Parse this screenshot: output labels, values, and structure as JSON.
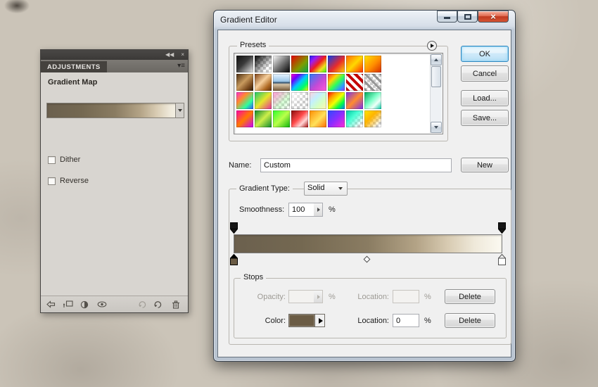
{
  "colors": {
    "stop_color": "#6b5c45",
    "gradient_bar": "linear-gradient(to right, #6b604e 0%, #746851 25%, #8a7c62 50%, #b3a386 68%, #d8cbb2 80%, #efe9da 90%, #fbf9f1 100%)"
  },
  "adjustments": {
    "collapse_icon": "◀◀",
    "close_icon": "×",
    "menu_icon": "▾≡",
    "tab": "ADJUSTMENTS",
    "title": "Gradient Map",
    "dither_label": "Dither",
    "reverse_label": "Reverse"
  },
  "dialog": {
    "title": "Gradient Editor",
    "buttons": {
      "ok": "OK",
      "cancel": "Cancel",
      "load": "Load...",
      "save": "Save...",
      "new": "New"
    },
    "name": {
      "label": "Name:",
      "value": "Custom"
    },
    "gradient_type": {
      "label": "Gradient Type:",
      "value": "Solid"
    },
    "smoothness": {
      "label": "Smoothness:",
      "value": "100"
    },
    "percent": "%",
    "presets": {
      "label": "Presets",
      "items": [
        "linear-gradient(135deg,#111 0%,#3a3a3a 45%,#e8e8e8 100%)",
        "linear-gradient(135deg,#000 0%,rgba(0,0,0,0) 75%), repeating-conic-gradient(#cbcbcb 0% 25%,#fff 0% 50%) 0 0/8px 8px",
        "linear-gradient(135deg,#fff 0%,#777 50%,#000 100%)",
        "linear-gradient(135deg,#e70000 0%,#7d9c00 60%,#00a651 100%)",
        "linear-gradient(135deg,#1524f5 0%,#9c1df0 25%,#f01d1d 50%,#f0e11d 75%,#2df01d 100%)",
        "linear-gradient(135deg,#0540f2 0%,#e82b2b 55%,#ffd400 100%)",
        "linear-gradient(135deg,#ff6a00 0%,#ffd800 50%,#ff2a00 100%)",
        "linear-gradient(135deg,#ffe600 0%,#ff8c00 55%,#d42b00 100%)",
        "linear-gradient(135deg,#4a2c10 0%,#c89a5e 45%,#7a4a1e 75%,#2f1c08 100%)",
        "linear-gradient(135deg,#7c3f12 0%,#f6cf9c 45%,#b06a24 75%,#5d2f0c 100%)",
        "linear-gradient(180deg,#e9f5ff 0%,#9cc6e8 44%,#30506e 52%,#d8c5a8 62%,#715636 100%)",
        "linear-gradient(135deg,#ff00cc 0%,#6a00ff 25%,#00c8ff 50%,#00ff66 75%,#ffee00 100%)",
        "linear-gradient(135deg,#2a7cf7 0%,#c44ad6 55%,#ff5ad5 100%)",
        "linear-gradient(135deg,#ff2d2d 0%,#ffd400 30%,#2dff5a 55%,#2d9bff 80%,#a02dff 100%)",
        "repeating-linear-gradient(45deg,#c40000 0 4px,#fff 4px 8px)",
        "repeating-linear-gradient(45deg,rgba(140,140,140,.9) 0 3px,rgba(255,255,255,0) 3px 8px), repeating-conic-gradient(#cbcbcb 0% 25%,#fff 0% 50%) 0 0/8px 8px",
        "linear-gradient(135deg,#ff2dce 0%,#ff8c2d 35%,#2dff9b 70%,#2d55ff 100%)",
        "linear-gradient(135deg,#19c86e 0%,#e6e62d 50%,#e62d9b 100%)",
        "linear-gradient(135deg,#ff9bd5 0%,rgba(155,255,155,.4) 60%,rgba(255,255,255,0) 100%), repeating-conic-gradient(#cbcbcb 0% 25%,#fff 0% 50%) 0 0/8px 8px",
        "linear-gradient(135deg,#fff 0%,rgba(255,255,255,0) 60%), repeating-conic-gradient(#cbcbcb 0% 25%,#fff 0% 50%) 0 0/8px 8px",
        "linear-gradient(135deg,#ffd1dc 0%,#c3f0ff 35%,#d5ffc3 65%,#fff3b0 100%)",
        "linear-gradient(135deg,#ff0000 0%,#ff9b00 25%,#f2ff00 50%,#00ff44 75%,#0077ff 100%)",
        "linear-gradient(135deg,#7a2df0 0%,#ff8c2d 50%,#7a2df0 100%)",
        "linear-gradient(135deg,#00a85a 0%,#7dffc8 45%,#f0fff8 70%,#00c8a0 100%)",
        "linear-gradient(135deg,#ff00a8 0%,#ff7a00 50%,#c800ff 100%)",
        "linear-gradient(135deg,#0b8a2d 0%,#cdee4a 50%,#0b8a2d 100%)",
        "linear-gradient(135deg,#2dff2d 0%,#baff4a 50%,#0bb40b 100%)",
        "linear-gradient(135deg,#8a0b0b 0%,#ff4a4a 45%,#ffd5d5 70%,#a80b0b 100%)",
        "linear-gradient(135deg,#ff8c00 0%,#ffe15a 55%,#ff6a00 100%)",
        "linear-gradient(135deg,#2d4aff 0%,#8c2dff 50%,#ff2dd5 100%)",
        "linear-gradient(135deg,#00c8a0 0%,#4affd5 40%,rgba(74,255,213,0) 85%), repeating-conic-gradient(#cbcbcb 0% 25%,#fff 0% 50%) 0 0/8px 8px",
        "linear-gradient(135deg,#ffe600 0%,#ffb400 40%,rgba(255,180,0,0) 85%), repeating-conic-gradient(#cbcbcb 0% 25%,#fff 0% 50%) 0 0/8px 8px"
      ]
    },
    "stops": {
      "label": "Stops",
      "opacity_label": "Opacity:",
      "opacity_value": "",
      "location_label": "Location:",
      "opacity_location_value": "",
      "color_label": "Color:",
      "color_location_value": "0",
      "delete_label": "Delete"
    }
  }
}
